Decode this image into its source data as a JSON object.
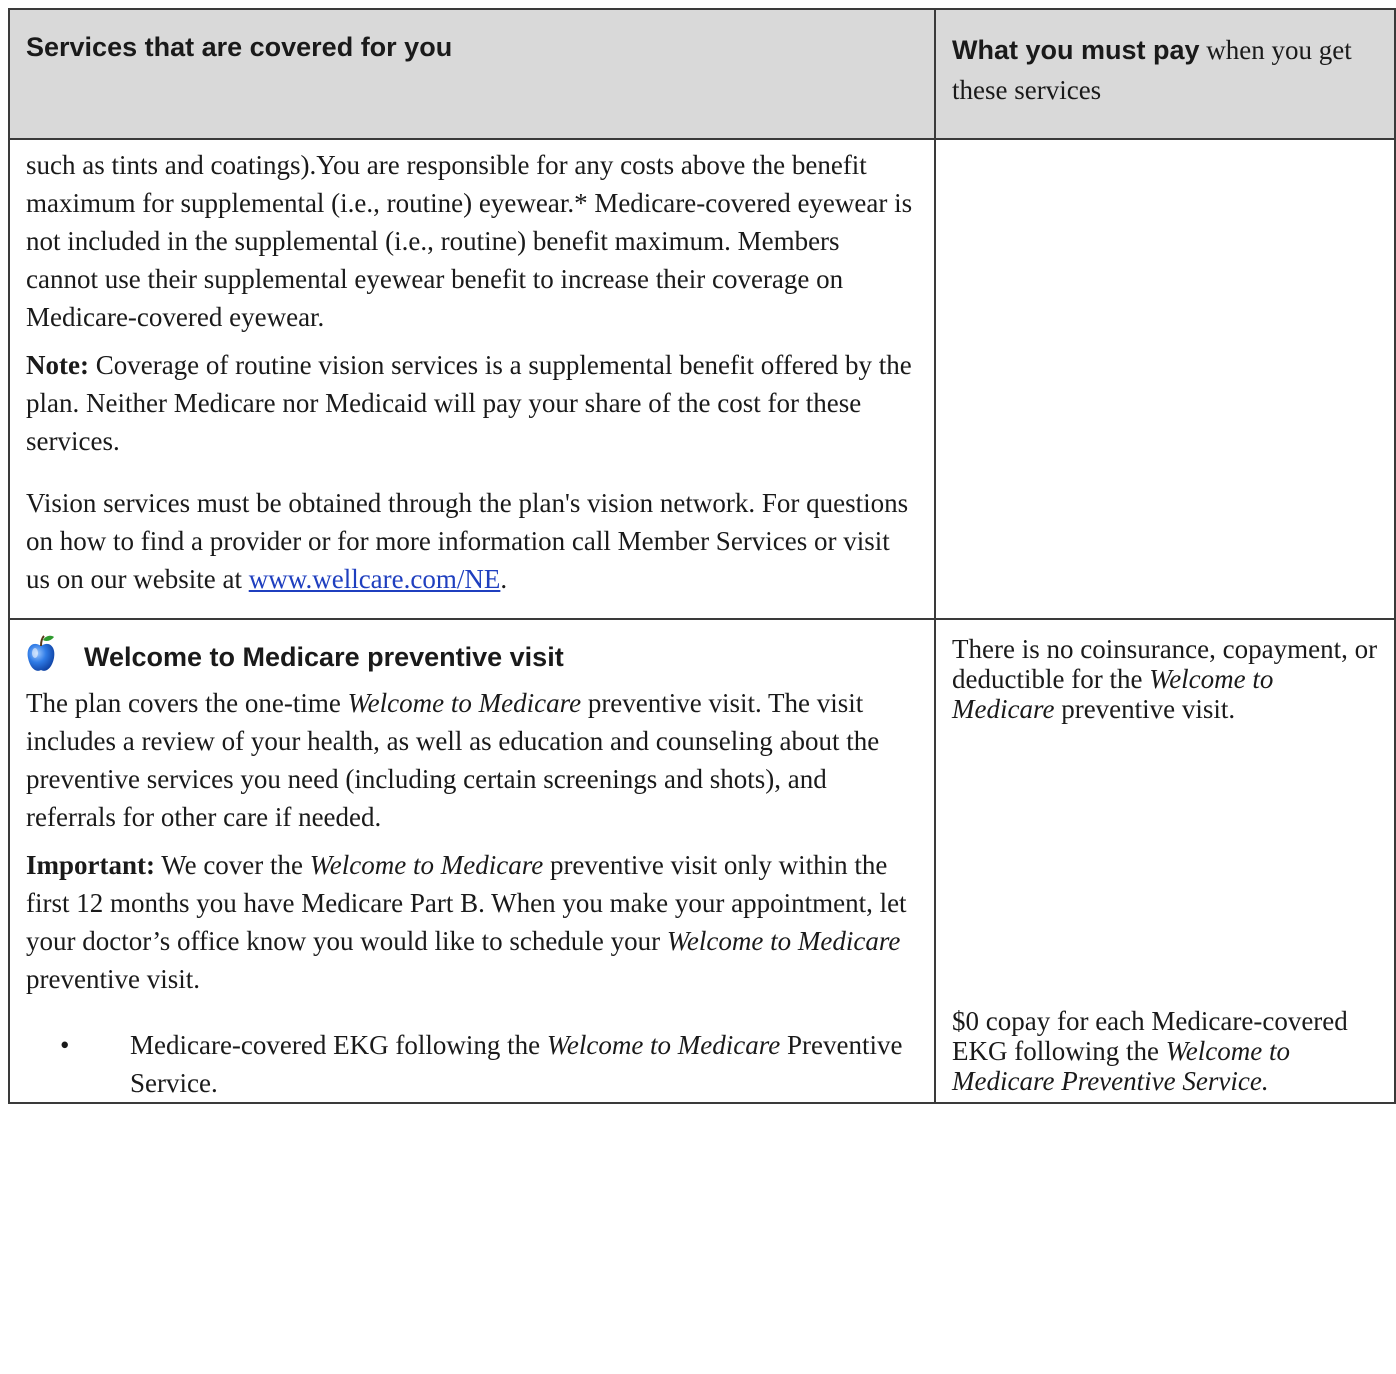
{
  "header": {
    "left_title": "Services that are covered for you",
    "right_title_bold": "What you must pay",
    "right_title_rest": " when you get these services"
  },
  "row1": {
    "para1": "such as tints and coatings).You are responsible for any costs above the benefit maximum for supplemental (i.e., routine) eyewear.* Medicare-covered eyewear is not included in the supplemental (i.e., routine) benefit maximum. Members cannot use their supplemental eyewear benefit to increase their coverage on Medicare-covered eyewear.",
    "note_label": "Note:",
    "note_text": " Coverage of routine vision services is a supplemental benefit offered by the plan. Neither Medicare nor Medicaid will pay your share of the cost for these services.",
    "para3_text": "Vision services must be obtained through the plan's vision network. For questions on how to find a provider or for more information call Member Services or visit us on our website at ",
    "link_text": "www.wellcare.com/NE",
    "para3_end": "."
  },
  "row2": {
    "icon": "apple-icon",
    "title": "Welcome to Medicare preventive visit",
    "p1_a": "The plan covers the one-time ",
    "p1_em": "Welcome to Medicare",
    "p1_b": " preventive visit. The visit includes a review of your health, as well as education and counseling about the preventive services you need (including certain screenings and shots), and referrals for other care if needed.",
    "imp_label": "Important:",
    "imp_a": " We cover the ",
    "imp_em1": "Welcome to Medicare",
    "imp_b": " preventive visit only within the first 12 months you have Medicare Part B. When you make your appointment, let your doctor’s office know you would like to schedule your ",
    "imp_em2": "Welcome to Medicare",
    "imp_c": " preventive visit.",
    "bullet_symbol": "•",
    "bullet_a": "Medicare-covered EKG following the ",
    "bullet_em": "Welcome to Medicare",
    "bullet_b": " Preventive Service.",
    "right_a": "There is no coinsurance, copayment, or deductible for the ",
    "right_em": "Welcome to Medicare",
    "right_b": " preventive visit.",
    "right2_a": "$0 copay for each Medicare-covered EKG following the ",
    "right2_em": "Welcome to Medicare Preventive Service."
  },
  "colors": {
    "header_bg": "#d9d9d9",
    "link": "#1f3fbf",
    "apple_blue": "#1e5fd1"
  }
}
